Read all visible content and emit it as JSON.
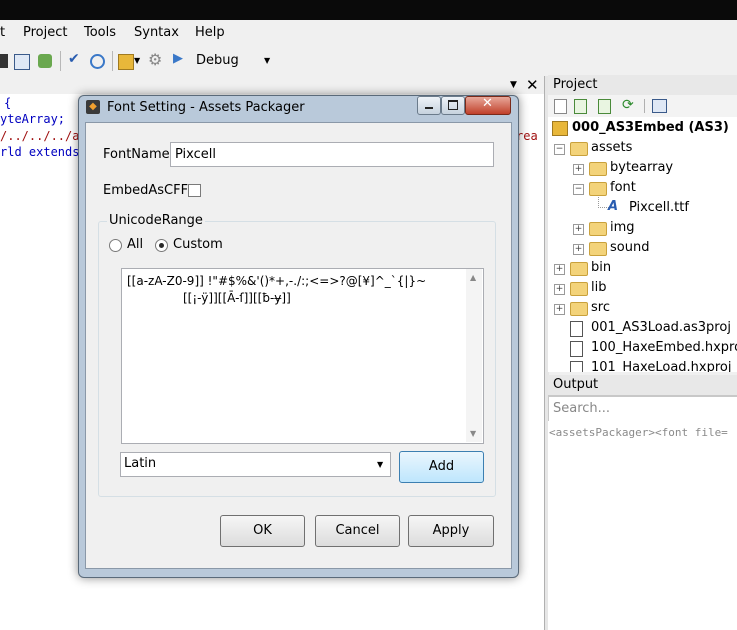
{
  "menu": [
    "t",
    "Project",
    "Tools",
    "Syntax",
    "Help"
  ],
  "toolbar": {
    "config": "Debug"
  },
  "editor": {
    "lines": [
      "{",
      "yteArray;",
      "/../../../a",
      "rld extends"
    ],
    "right_fragment": "rea"
  },
  "project_panel": {
    "title": "Project",
    "tree": [
      {
        "label": "000_AS3Embed (AS3)",
        "bold": true
      },
      {
        "label": "assets"
      },
      {
        "label": "bytearray"
      },
      {
        "label": "font"
      },
      {
        "label": "Pixcell.ttf"
      },
      {
        "label": "img"
      },
      {
        "label": "sound"
      },
      {
        "label": "bin"
      },
      {
        "label": "lib"
      },
      {
        "label": "src"
      },
      {
        "label": "001_AS3Load.as3proj"
      },
      {
        "label": "100_HaxeEmbed.hxproj"
      },
      {
        "label": "101_HaxeLoad.hxproj"
      }
    ]
  },
  "output_panel": {
    "title": "Output",
    "search_placeholder": "Search...",
    "text": "<assetsPackager><font file="
  },
  "dialog": {
    "title": "Font Setting - Assets Packager",
    "fontname_label": "FontName",
    "fontname_value": "Pixcell",
    "embed_label": "EmbedAsCFF",
    "range_label": "UnicodeRange",
    "radio_all": "All",
    "radio_custom": "Custom",
    "range_line1": "[[a-zA-Z0-9]] !\"#$%&'()*+,-./:;<=>?@[¥]^_`{|}~",
    "range_line2": "[[¡-ÿ]][[Ā-ſ]][[ƀ-ɏ]]",
    "preset_value": "Latin",
    "add_label": "Add",
    "ok_label": "OK",
    "cancel_label": "Cancel",
    "apply_label": "Apply"
  }
}
